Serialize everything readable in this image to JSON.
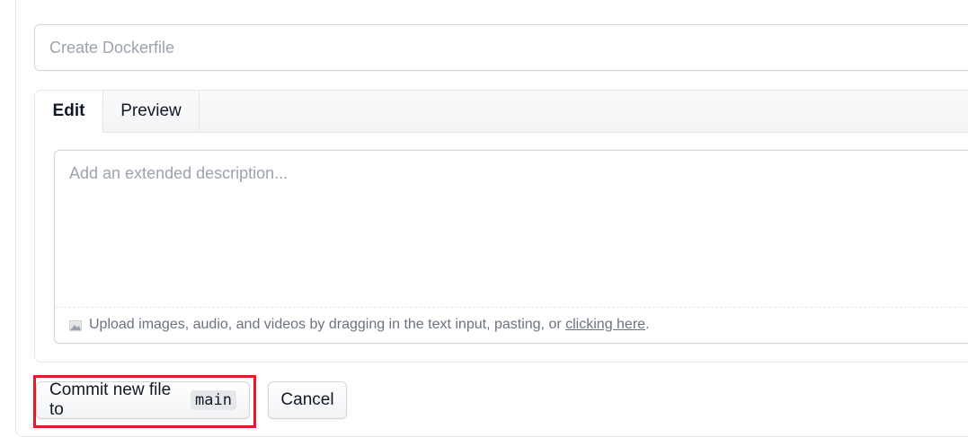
{
  "summary": {
    "placeholder": "Create Dockerfile",
    "value": ""
  },
  "editor": {
    "tabs": [
      {
        "label": "Edit",
        "active": true
      },
      {
        "label": "Preview",
        "active": false
      }
    ],
    "description": {
      "placeholder": "Add an extended description...",
      "value": ""
    },
    "upload": {
      "text": "Upload images, audio, and videos by dragging in the text input, pasting, or ",
      "link": "clicking here",
      "suffix": ".",
      "icon": "image-icon"
    }
  },
  "actions": {
    "commit_label": "Commit new file to",
    "branch": "main",
    "cancel_label": "Cancel",
    "highlight_color": "#e11d2a"
  }
}
